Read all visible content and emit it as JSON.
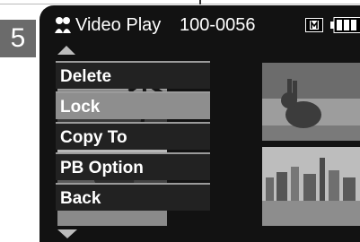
{
  "step_number": "5",
  "status_bar": {
    "mode_label": "Video Play",
    "file_number": "100-0056"
  },
  "menu": {
    "items": [
      "Delete",
      "Lock",
      "Copy To",
      "PB Option",
      "Back"
    ]
  },
  "icons": {
    "mode": "people-icon",
    "storage": "memory-card-icon",
    "battery": "battery-icon",
    "scroll_up": "up-arrow-icon",
    "scroll_down": "down-arrow-icon"
  }
}
